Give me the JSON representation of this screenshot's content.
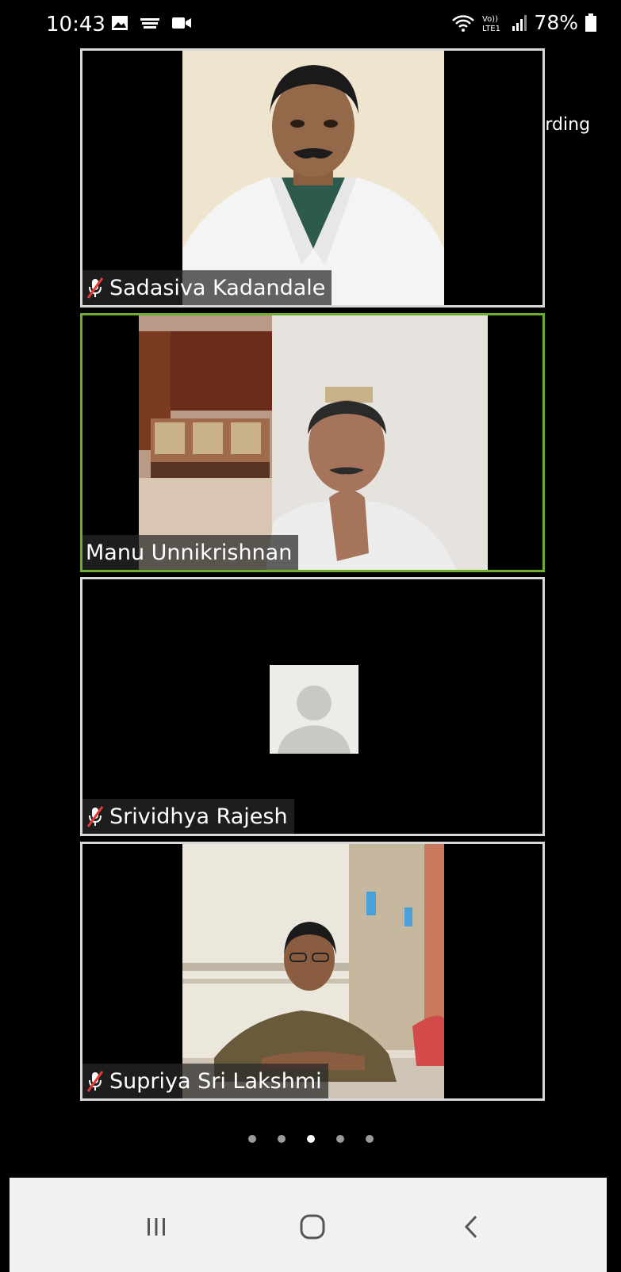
{
  "status_bar": {
    "time": "10:43",
    "battery": "78%",
    "icons": [
      "gallery-icon",
      "media-icon",
      "video-camera-icon",
      "wifi-icon",
      "volte-icon",
      "signal-icon",
      "battery-icon"
    ]
  },
  "recording": {
    "label": "Recording",
    "color": "#e8202a"
  },
  "participants": [
    {
      "name": "Sadasiva Kadandale",
      "muted": true,
      "active_speaker": false
    },
    {
      "name": "Manu Unnikrishnan",
      "muted": false,
      "active_speaker": true
    },
    {
      "name": "Srividhya Rajesh",
      "muted": true,
      "active_speaker": false,
      "video_off": true
    },
    {
      "name": "Supriya Sri Lakshmi",
      "muted": true,
      "active_speaker": false
    }
  ],
  "pagination": {
    "total": 5,
    "current": 3
  },
  "colors": {
    "active_border": "#6fae2d",
    "tile_border": "#d8d8d8",
    "mute_red": "#e53935"
  },
  "nav_bar": {
    "buttons": [
      "recent-apps-icon",
      "home-icon",
      "back-icon"
    ]
  }
}
